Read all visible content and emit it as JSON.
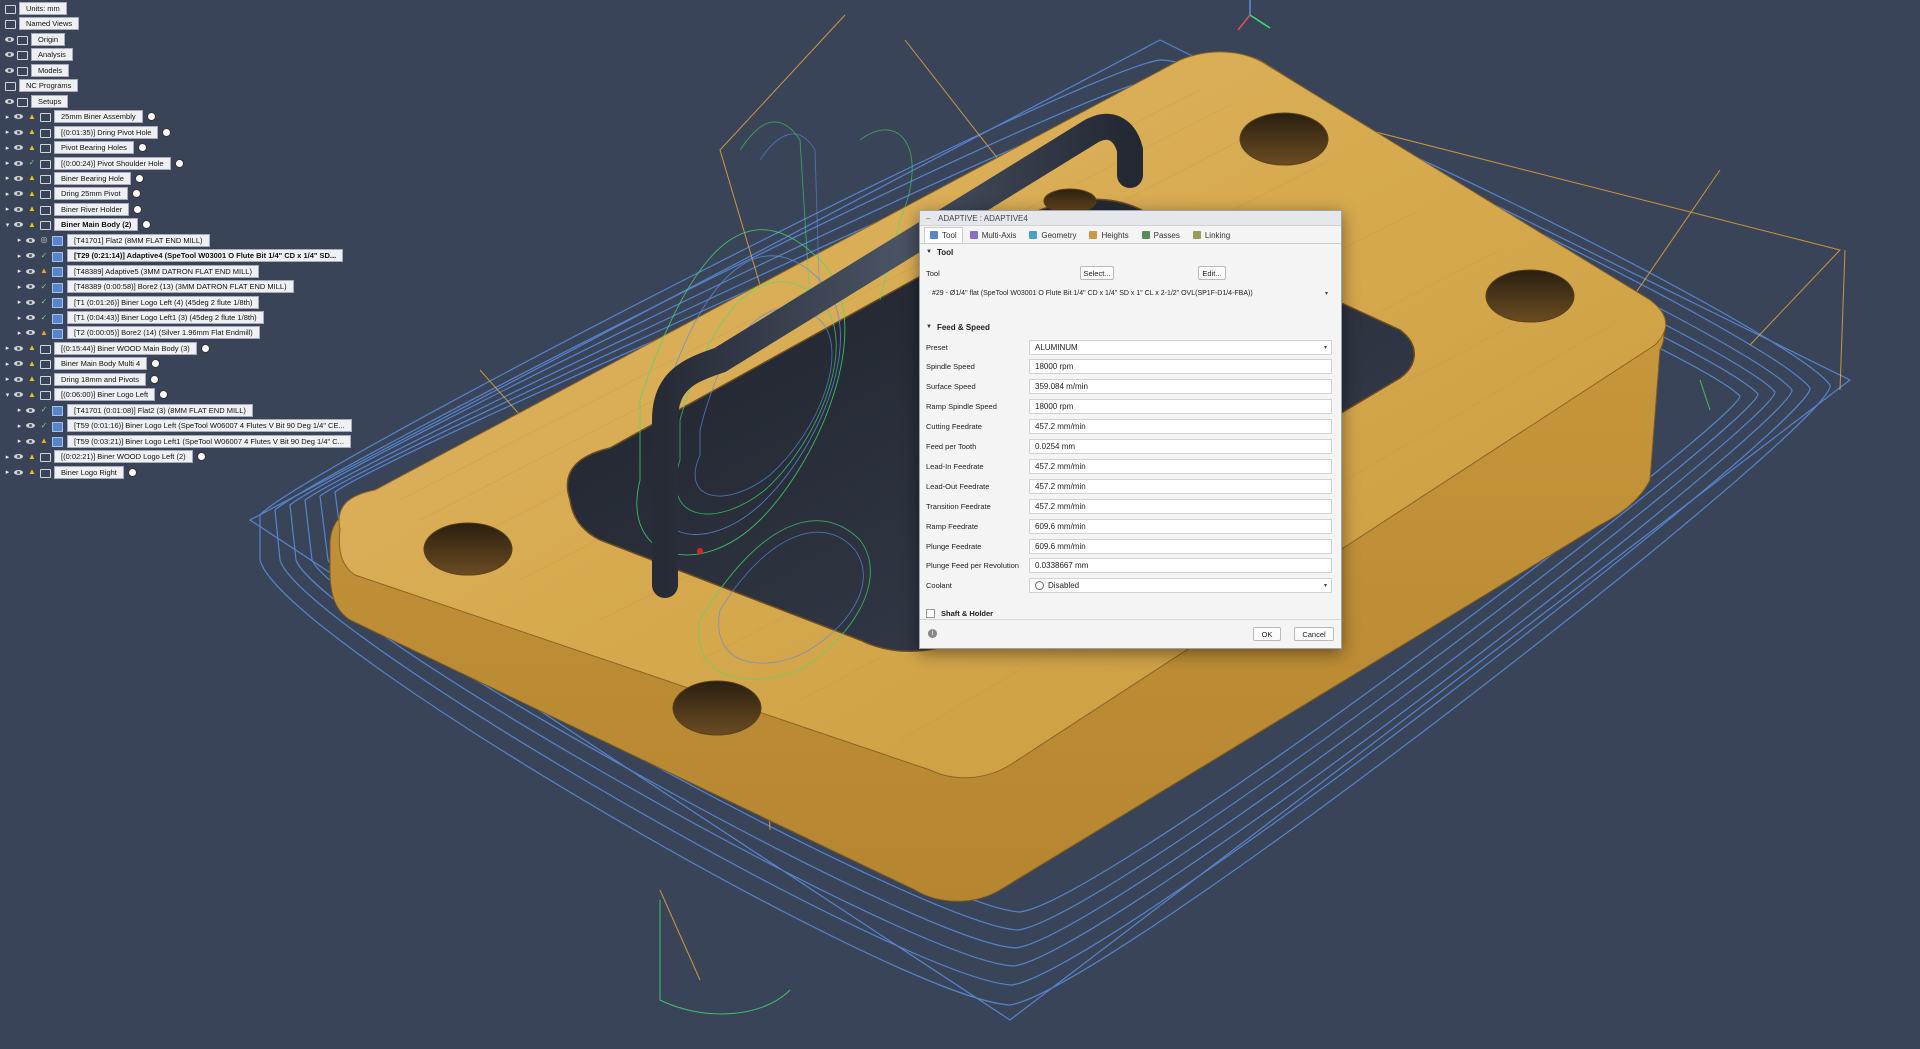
{
  "tree": [
    {
      "label": "Units: mm",
      "type": "units"
    },
    {
      "label": "Named Views",
      "type": "folder"
    },
    {
      "label": "Origin",
      "type": "folder",
      "eye": true
    },
    {
      "label": "Analysis",
      "type": "folder",
      "eye": true
    },
    {
      "label": "Models",
      "type": "folder",
      "eye": true
    },
    {
      "label": "NC Programs",
      "type": "folder"
    },
    {
      "label": "Setups",
      "type": "folder",
      "eye": true
    },
    {
      "label": "25mm Biner Assembly",
      "depth": 1,
      "status": "warn",
      "radio": true
    },
    {
      "label": "[(0:01:35)] Dring Pivot Hole",
      "depth": 1,
      "status": "warn",
      "radio": true
    },
    {
      "label": "Pivot Bearing Holes",
      "depth": 1,
      "status": "warn",
      "radio": true
    },
    {
      "label": "[(0:00:24)] Pivot Shoulder Hole",
      "depth": 1,
      "status": "ok",
      "radio": true
    },
    {
      "label": "Biner Bearing Hole",
      "depth": 1,
      "status": "warn",
      "radio": true
    },
    {
      "label": "Dring 25mm Pivot",
      "depth": 1,
      "status": "warn",
      "radio": true
    },
    {
      "label": "Biner River Holder",
      "depth": 1,
      "status": "warn",
      "radio": true
    },
    {
      "label": "Biner Main Body (2)",
      "depth": 1,
      "status": "warn",
      "radio": true,
      "expanded": true,
      "active": true
    },
    {
      "label": "[T41701] Flat2 (8MM FLAT END MILL)",
      "depth": 2,
      "status": "gen",
      "op": true
    },
    {
      "label": "[T29 (0:21:14)] Adaptive4 (SpeTool W03001 O Flute Bit 1/4\" CD x 1/4\" SD...",
      "depth": 2,
      "status": "ok",
      "op": true,
      "active": true
    },
    {
      "label": "[T48389] Adaptive5 (3MM DATRON FLAT END MILL)",
      "depth": 2,
      "status": "err",
      "op": true
    },
    {
      "label": "[T48389 (0:00:58)] Bore2 (13) (3MM DATRON FLAT END MILL)",
      "depth": 2,
      "status": "ok",
      "op": true
    },
    {
      "label": "[T1 (0:01:26)] Biner Logo Left (4) (45deg 2 flute 1/8th)",
      "depth": 2,
      "status": "ok",
      "op": true
    },
    {
      "label": "[T1 (0:04:43)] Biner Logo Left1 (3) (45deg 2 flute 1/8th)",
      "depth": 2,
      "status": "ok",
      "op": true
    },
    {
      "label": "[T2 (0:00:05)] Bore2 (14) (Silver 1.96mm Flat Endmill)",
      "depth": 2,
      "status": "err",
      "op": true
    },
    {
      "label": "[(0:15:44)] Biner WOOD Main Body (3)",
      "depth": 1,
      "status": "warn",
      "radio": true
    },
    {
      "label": "Biner Main Body Multi 4",
      "depth": 1,
      "status": "warn",
      "radio": true
    },
    {
      "label": "Dring 18mm and Pivots",
      "depth": 1,
      "status": "warn",
      "radio": true
    },
    {
      "label": "[(0:06:00)] Biner Logo Left",
      "depth": 1,
      "status": "warn",
      "radio": true,
      "expanded": true
    },
    {
      "label": "[T41701 (0:01:08)] Flat2 (3) (8MM FLAT END MILL)",
      "depth": 2,
      "status": "ok",
      "op": true
    },
    {
      "label": "[T59 (0:01:16)] Biner Logo Left (SpeTool W06007 4 Flutes V Bit 90 Deg 1/4\" CE...",
      "depth": 2,
      "status": "ok",
      "op": true
    },
    {
      "label": "[T59 (0:03:21)] Biner Logo Left1 (SpeTool W06007 4 Flutes V Bit 90 Deg 1/4\" C...",
      "depth": 2,
      "status": "err",
      "op": true
    },
    {
      "label": "[(0:02:21)] Biner WOOD Logo Left (2)",
      "depth": 1,
      "status": "warn",
      "radio": true
    },
    {
      "label": "Biner Logo Right",
      "depth": 1,
      "status": "warn",
      "radio": true
    }
  ],
  "dialog": {
    "title": "ADAPTIVE : ADAPTIVE4",
    "tabs": [
      "Tool",
      "Multi-Axis",
      "Geometry",
      "Heights",
      "Passes",
      "Linking"
    ],
    "tool_section": "Tool",
    "tool_label": "Tool",
    "select_button": "Select...",
    "edit_button": "Edit...",
    "tool_value": "#29 - Ø1/4\" flat (SpeTool W03001 O Flute Bit 1/4\" CD x 1/4\" SD x 1\" CL x 2-1/2\" OVL(SP1F-D1/4-FBA))",
    "feed_section": "Feed & Speed",
    "params": [
      {
        "label": "Preset",
        "value": "ALUMINUM",
        "combo": true
      },
      {
        "label": "Spindle Speed",
        "value": "18000 rpm"
      },
      {
        "label": "Surface Speed",
        "value": "359.084 m/min"
      },
      {
        "label": "Ramp Spindle Speed",
        "value": "18000 rpm"
      },
      {
        "label": "Cutting Feedrate",
        "value": "457.2 mm/min"
      },
      {
        "label": "Feed per Tooth",
        "value": "0.0254 mm"
      },
      {
        "label": "Lead-In Feedrate",
        "value": "457.2 mm/min"
      },
      {
        "label": "Lead-Out Feedrate",
        "value": "457.2 mm/min"
      },
      {
        "label": "Transition Feedrate",
        "value": "457.2 mm/min"
      },
      {
        "label": "Ramp Feedrate",
        "value": "609.6 mm/min"
      },
      {
        "label": "Plunge Feedrate",
        "value": "609.6 mm/min"
      },
      {
        "label": "Plunge Feed per Revolution",
        "value": "0.0338667 mm"
      },
      {
        "label": "Coolant",
        "value": "Disabled",
        "combo": true
      }
    ],
    "shaft_label": "Shaft & Holder",
    "ok": "OK",
    "cancel": "Cancel"
  },
  "colors": {
    "background": "#3a4458",
    "wood": "#d6a94e",
    "toolpath_blue": "#5b8fe0",
    "toolpath_green": "#3ee06b",
    "toolpath_orange": "#e8a33c"
  }
}
